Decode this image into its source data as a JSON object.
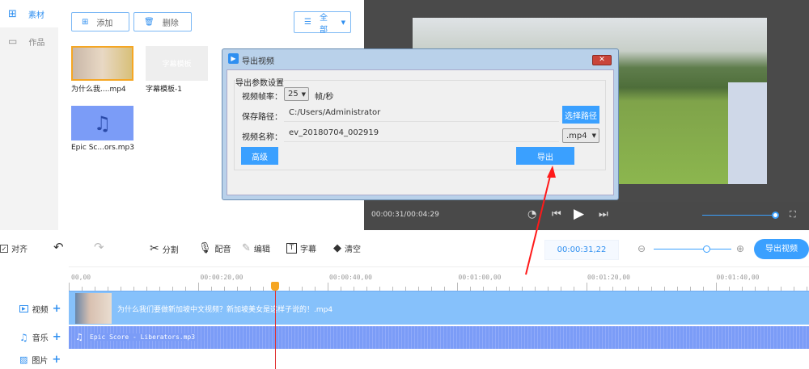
{
  "sidebar": {
    "items": [
      {
        "label": "素材",
        "icon": "grid-icon",
        "selected": true
      },
      {
        "label": "作品",
        "icon": "folder-icon",
        "selected": false
      }
    ]
  },
  "media": {
    "add_label": "添加",
    "delete_label": "删除",
    "filter": "全部",
    "items": [
      {
        "name": "为什么我....mp4",
        "type": "video"
      },
      {
        "name": "字幕模板-1",
        "type": "subtitle",
        "thumb_text": "字幕模板"
      },
      {
        "name": "Epic Sc...ors.mp3",
        "type": "audio"
      }
    ]
  },
  "player": {
    "time": "00:00:31/00:04:29",
    "volume": 0.92
  },
  "dialog": {
    "title": "导出视频",
    "group_title": "导出参数设置",
    "fps_label": "视频帧率：",
    "fps_value": "25",
    "fps_unit": "帧/秒",
    "path_label": "保存路径：",
    "path_value": "C:/Users/Administrator",
    "choose_path": "选择路径",
    "name_label": "视频名称：",
    "name_value": "ev_20180704_002919",
    "format": ".mp4",
    "advanced": "高级",
    "export": "导出"
  },
  "toolbar": {
    "align": "对齐",
    "align_checked": true,
    "split": "分割",
    "dub": "配音",
    "edit": "编辑",
    "subtitle": "字幕",
    "clear": "清空",
    "timecode": "00:00:31,22",
    "zoom_level": 0.7,
    "export_video": "导出视频"
  },
  "timeline": {
    "ticks": [
      "00,00",
      "00:00:20,00",
      "00:00:40,00",
      "00:01:00,00",
      "00:01:20,00",
      "00:01:40,00"
    ],
    "tracks": [
      {
        "label": "视频",
        "clip": "为什么我们要做新加坡中文视频？新加坡美女是这样子说的！.mp4"
      },
      {
        "label": "音乐",
        "clip": "Epic Score - Liberators.mp3"
      },
      {
        "label": "图片"
      }
    ]
  },
  "colors": {
    "accent": "#3aa0ff",
    "video_track": "#86c1fb",
    "music_track": "#7b9cf7",
    "playhead": "#f5a623"
  }
}
